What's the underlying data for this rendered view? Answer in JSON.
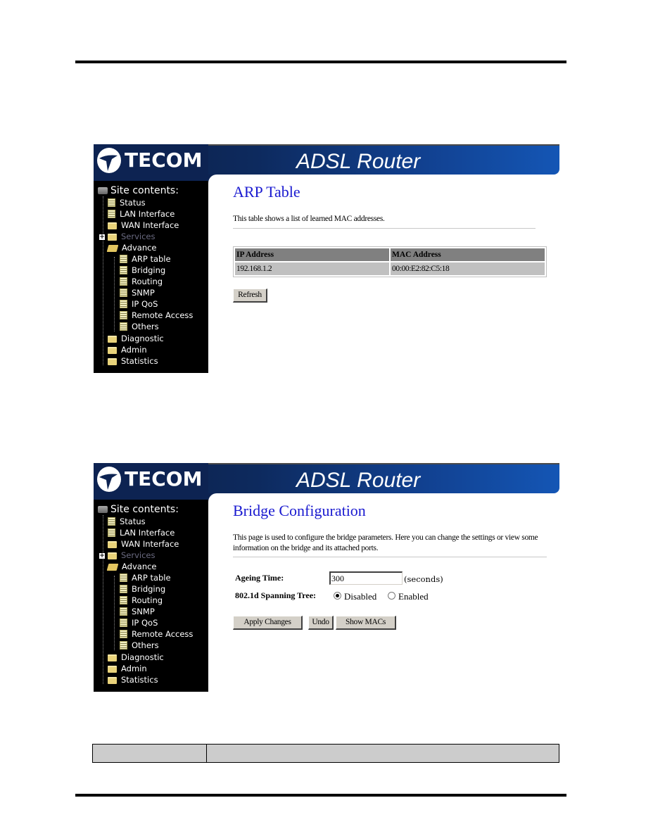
{
  "document": {
    "screenshots": [
      {
        "brand": "TECOM",
        "product_title": "ADSL Router",
        "sidebar": {
          "title": "Site contents:",
          "items": [
            {
              "label": "Status",
              "type": "page"
            },
            {
              "label": "LAN Interface",
              "type": "page"
            },
            {
              "label": "WAN Interface",
              "type": "folder"
            },
            {
              "label": "Services",
              "type": "folder",
              "collapsed": true,
              "dimmed": true
            },
            {
              "label": "Advance",
              "type": "folder-open"
            },
            {
              "label": "ARP table",
              "type": "page",
              "child": true
            },
            {
              "label": "Bridging",
              "type": "page",
              "child": true
            },
            {
              "label": "Routing",
              "type": "page",
              "child": true
            },
            {
              "label": "SNMP",
              "type": "page",
              "child": true
            },
            {
              "label": "IP QoS",
              "type": "page",
              "child": true
            },
            {
              "label": "Remote Access",
              "type": "page",
              "child": true
            },
            {
              "label": "Others",
              "type": "page",
              "child": true
            },
            {
              "label": "Diagnostic",
              "type": "folder"
            },
            {
              "label": "Admin",
              "type": "folder"
            },
            {
              "label": "Statistics",
              "type": "folder"
            }
          ]
        },
        "page": {
          "title": "ARP Table",
          "description": "This table shows a list of learned MAC addresses.",
          "table": {
            "headers": [
              "IP Address",
              "MAC Address"
            ],
            "rows": [
              [
                "192.168.1.2",
                "00:00:E2:82:C5:18"
              ]
            ]
          },
          "refresh_label": "Refresh"
        }
      },
      {
        "brand": "TECOM",
        "product_title": "ADSL Router",
        "sidebar": {
          "title": "Site contents:",
          "items": [
            {
              "label": "Status"
            },
            {
              "label": "LAN Interface"
            },
            {
              "label": "WAN Interface"
            },
            {
              "label": "Services"
            },
            {
              "label": "Advance"
            },
            {
              "label": "ARP table"
            },
            {
              "label": "Bridging"
            },
            {
              "label": "Routing"
            },
            {
              "label": "SNMP"
            },
            {
              "label": "IP QoS"
            },
            {
              "label": "Remote Access"
            },
            {
              "label": "Others"
            },
            {
              "label": "Diagnostic"
            },
            {
              "label": "Admin"
            },
            {
              "label": "Statistics"
            }
          ]
        },
        "page": {
          "title": "Bridge Configuration",
          "description": "This page is used to configure the bridge parameters. Here you can change the settings or view some information on the bridge and its attached ports.",
          "ageing_time_label": "Ageing Time:",
          "ageing_time_value": "300",
          "ageing_time_unit": "(seconds)",
          "spanning_tree_label": "802.1d Spanning Tree:",
          "spanning_tree_options": [
            "Disabled",
            "Enabled"
          ],
          "spanning_tree_selected": "Disabled",
          "apply_label": "Apply Changes",
          "undo_label": "Undo",
          "show_macs_label": "Show MACs"
        }
      }
    ]
  }
}
